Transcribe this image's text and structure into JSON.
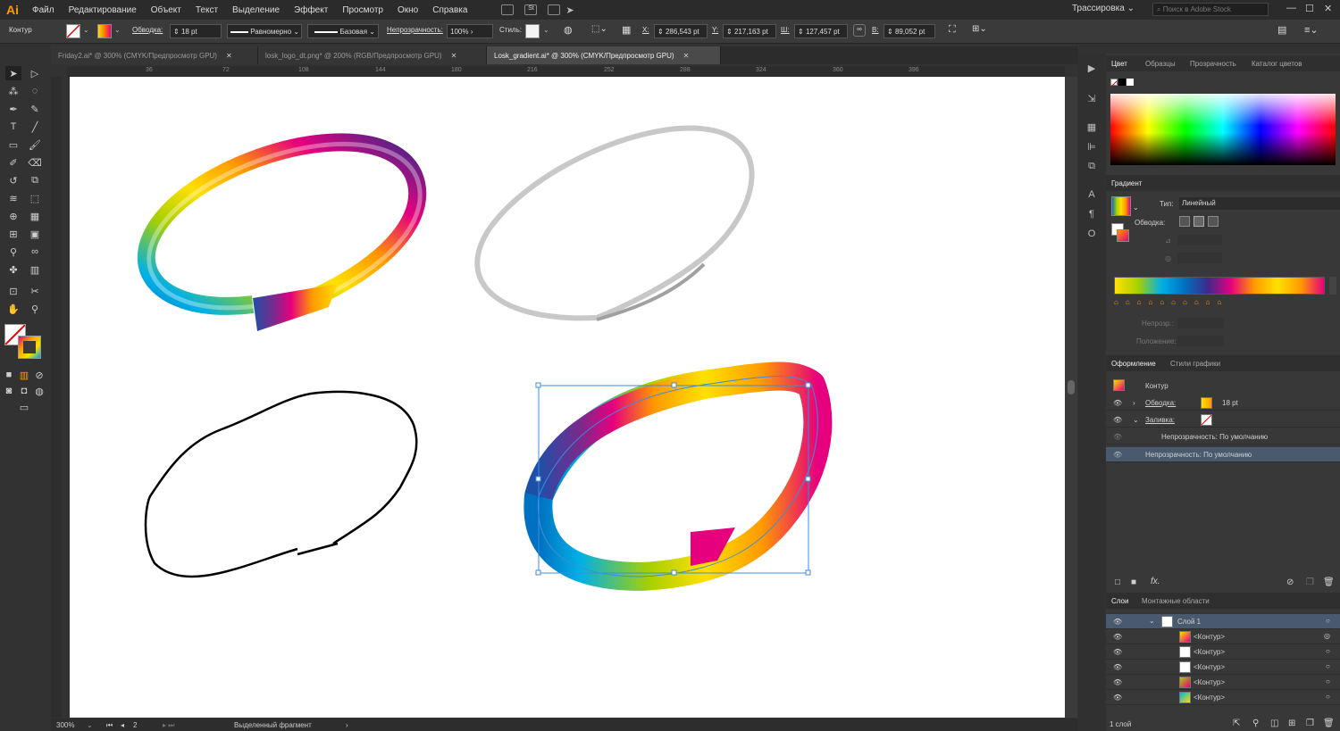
{
  "app": {
    "logo": "Ai"
  },
  "menu": [
    "Файл",
    "Редактирование",
    "Объект",
    "Текст",
    "Выделение",
    "Эффект",
    "Просмотр",
    "Окно",
    "Справка"
  ],
  "topbar": {
    "workspace": "Трассировка",
    "stock_placeholder": "Поиск в Adobe Stock"
  },
  "control": {
    "object_type": "Контур",
    "stroke_label": "Обводка:",
    "stroke_weight": "18 pt",
    "profile": "Равномерно",
    "brush": "Базовая",
    "opacity_label": "Непрозрачность:",
    "opacity": "100%",
    "style_label": "Стиль:",
    "x_label": "X:",
    "x": "286,543 pt",
    "y_label": "Y:",
    "y": "217,163 pt",
    "w_label": "Ш:",
    "w": "127,457 pt",
    "h_label": "В:",
    "h": "89,052 pt"
  },
  "tabs": [
    {
      "label": "Friday2.ai* @ 300% (CMYK/Предпросмотр GPU)"
    },
    {
      "label": "losk_logo_dt.png* @ 200% (RGB/Предпросмотр GPU)"
    },
    {
      "label": "Losk_gradient.ai* @ 300% (CMYK/Предпросмотр GPU)"
    }
  ],
  "ruler": [
    "36",
    "72",
    "108",
    "144",
    "180",
    "216",
    "252",
    "288",
    "324",
    "360",
    "396"
  ],
  "status": {
    "zoom": "300%",
    "artboard": "2",
    "tool": "Выделенный фрагмент"
  },
  "color_panel": {
    "tabs": [
      "Цвет",
      "Образцы",
      "Прозрачность",
      "Каталог цветов"
    ]
  },
  "gradient_panel": {
    "title": "Градиент",
    "type_label": "Тип:",
    "type_value": "Линейный",
    "stroke_label": "Обводка:",
    "opacity_label": "Непрозр.:",
    "position_label": "Положение:"
  },
  "appearance_panel": {
    "tabs": [
      "Оформление",
      "Стили графики"
    ],
    "object": "Контур",
    "stroke_label": "Обводка:",
    "stroke_value": "18 pt",
    "fill_label": "Заливка:",
    "inner_opacity": "Непрозрачность: По умолчанию",
    "opacity": "Непрозрачность: По умолчанию"
  },
  "layers_panel": {
    "tabs": [
      "Слои",
      "Монтажные области"
    ],
    "layer": "Слой 1",
    "items": [
      "<Контур>",
      "<Контур>",
      "<Контур>",
      "<Контур>",
      "<Контур>"
    ],
    "footer": "1 слой"
  },
  "colors": {
    "accent": "#ff9a00",
    "selection": "#3c8dde",
    "panel": "#383838",
    "bar": "#2b2b2b"
  }
}
